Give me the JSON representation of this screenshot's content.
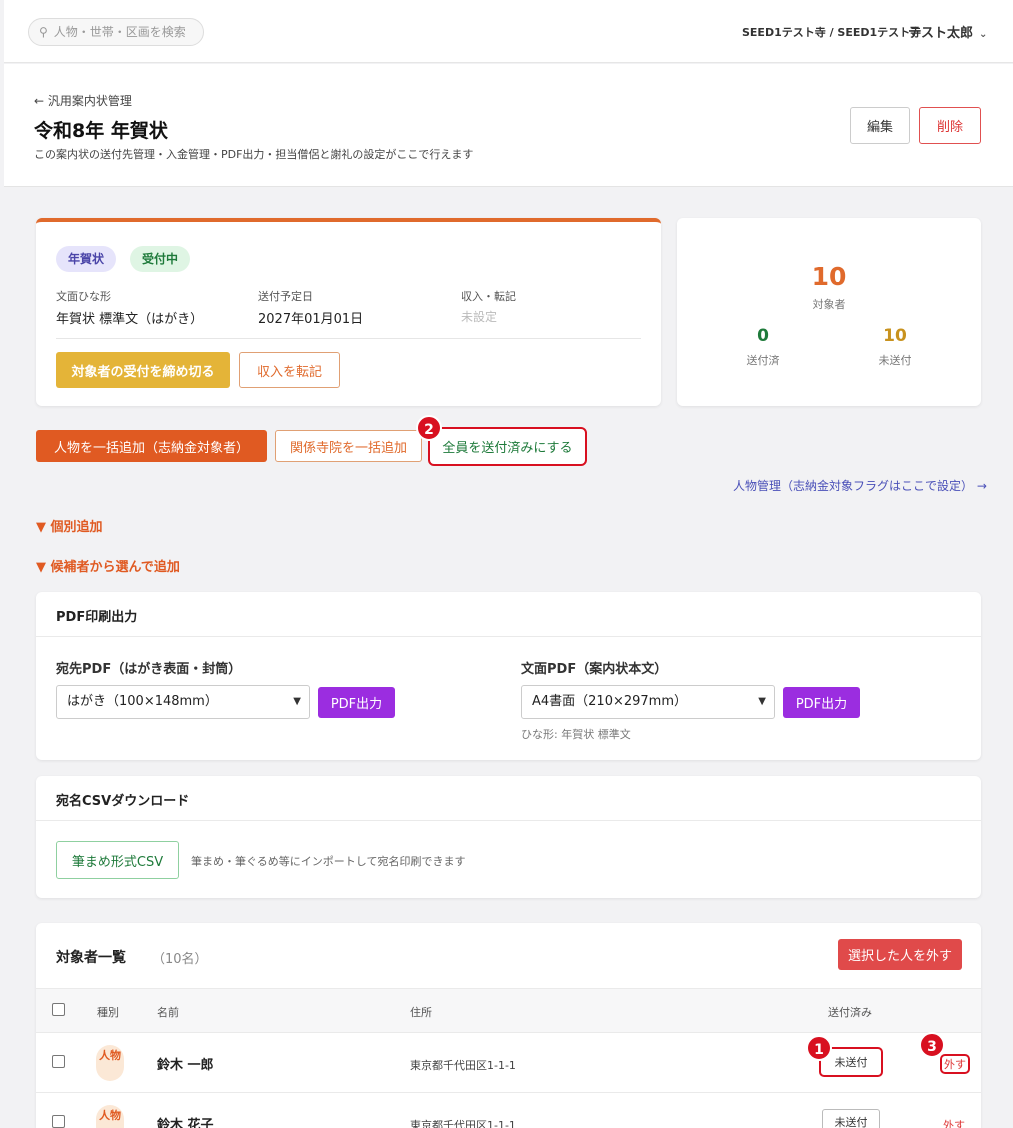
{
  "topbar": {
    "search_placeholder": "人物・世帯・区画を検索",
    "org": "SEED1テスト寺 / SEED1テスト寺",
    "user": "テスト太郎"
  },
  "header": {
    "back": "← 汎用案内状管理",
    "title": "令和8年 年賀状",
    "description": "この案内状の送付先管理・入金管理・PDF出力・担当僧侶と謝礼の設定がここで行えます",
    "edit": "編集",
    "delete": "削除"
  },
  "summary": {
    "badge_type": "年賀状",
    "badge_status": "受付中",
    "template_label": "文面ひな形",
    "template_value": "年賀状 標準文（はがき）",
    "send_date_label": "送付予定日",
    "send_date_value": "2027年01月01日",
    "income_label": "収入・転記",
    "income_value": "未設定",
    "close_button": "対象者の受付を締め切る",
    "transfer_button": "収入を転記"
  },
  "stats": {
    "total": "10",
    "total_label": "対象者",
    "sent": "0",
    "sent_label": "送付済",
    "unsent": "10",
    "unsent_label": "未送付",
    "colors": {
      "total": "#e06a2c",
      "sent": "#1e7a3a",
      "unsent": "#c8921e"
    }
  },
  "actions": {
    "bulk_person": "人物を一括追加（志納金対象者）",
    "bulk_temple": "関係寺院を一括追加",
    "all_sent": "全員を送付済みにする",
    "person_link": "人物管理（志納金対象フラグはここで設定） →",
    "individual_add": "▼ 個別追加",
    "candidate_add": "▼ 候補者から選んで追加"
  },
  "markers": {
    "m1": "1",
    "m2": "2",
    "m3": "3"
  },
  "pdf": {
    "title": "PDF印刷出力",
    "address_label": "宛先PDF（はがき表面・封筒）",
    "address_select": "はがき（100×148mm）",
    "body_label": "文面PDF（案内状本文）",
    "body_select": "A4書面（210×297mm）",
    "button": "PDF出力",
    "hint": "ひな形: 年賀状 標準文"
  },
  "csv": {
    "title": "宛名CSVダウンロード",
    "button": "筆まめ形式CSV",
    "hint": "筆まめ・筆ぐるめ等にインポートして宛名印刷できます"
  },
  "list": {
    "title": "対象者一覧",
    "count": "（10名）",
    "remove_selected": "選択した人を外す",
    "columns": {
      "type": "種別",
      "name": "名前",
      "address": "住所",
      "sent": "送付済み"
    },
    "rows": [
      {
        "type": "人物",
        "name": "鈴木 一郎",
        "address": "東京都千代田区1-1-1",
        "status": "未送付",
        "remove": "外す"
      },
      {
        "type": "人物",
        "name": "鈴木 花子",
        "address": "東京都千代田区1-1-1",
        "status": "未送付",
        "remove": "外す"
      }
    ]
  }
}
